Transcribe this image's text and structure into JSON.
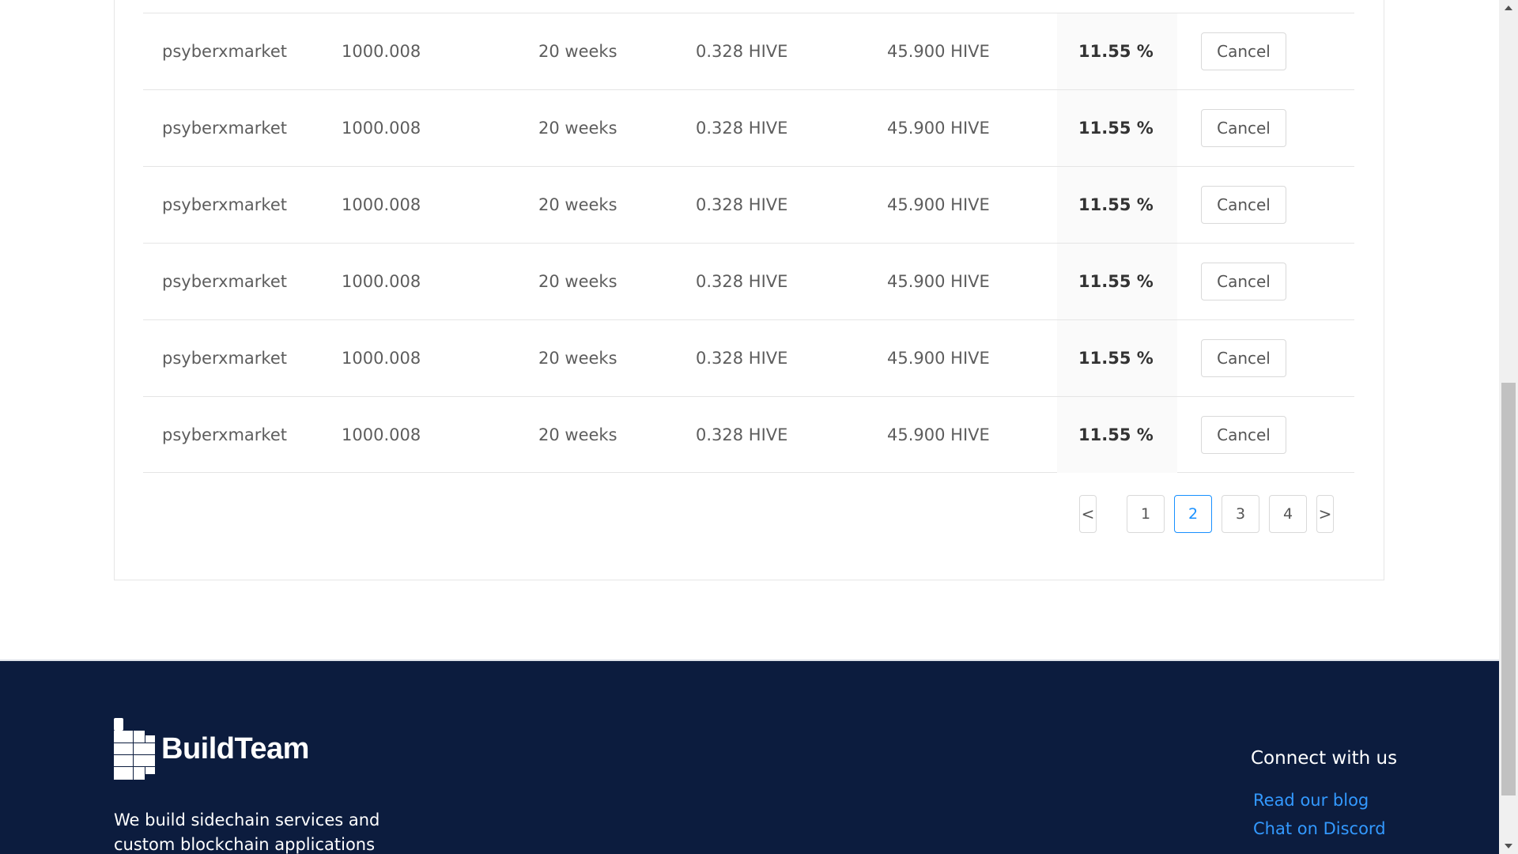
{
  "table": {
    "rows": [
      {
        "user": "psyberxmarket",
        "amount": "1000.008",
        "duration": "20 weeks",
        "fee": "0.328 HIVE",
        "total": "45.900 HIVE",
        "rate": "11.55 %",
        "action": "Cancel"
      },
      {
        "user": "psyberxmarket",
        "amount": "1000.008",
        "duration": "20 weeks",
        "fee": "0.328 HIVE",
        "total": "45.900 HIVE",
        "rate": "11.55 %",
        "action": "Cancel"
      },
      {
        "user": "psyberxmarket",
        "amount": "1000.008",
        "duration": "20 weeks",
        "fee": "0.328 HIVE",
        "total": "45.900 HIVE",
        "rate": "11.55 %",
        "action": "Cancel"
      },
      {
        "user": "psyberxmarket",
        "amount": "1000.008",
        "duration": "20 weeks",
        "fee": "0.328 HIVE",
        "total": "45.900 HIVE",
        "rate": "11.55 %",
        "action": "Cancel"
      },
      {
        "user": "psyberxmarket",
        "amount": "1000.008",
        "duration": "20 weeks",
        "fee": "0.328 HIVE",
        "total": "45.900 HIVE",
        "rate": "11.55 %",
        "action": "Cancel"
      },
      {
        "user": "psyberxmarket",
        "amount": "1000.008",
        "duration": "20 weeks",
        "fee": "0.328 HIVE",
        "total": "45.900 HIVE",
        "rate": "11.55 %",
        "action": "Cancel"
      }
    ]
  },
  "pagination": {
    "prev": "<",
    "next": ">",
    "pages": [
      "1",
      "2",
      "3",
      "4"
    ],
    "current": "2",
    "active_color": "#1890ff"
  },
  "footer": {
    "logo_text": "BuildTeam",
    "tagline": "We build sidechain services and custom blockchain applications",
    "connect_heading": "Connect with us",
    "links": [
      "Read our blog",
      "Chat on Discord"
    ],
    "background_color": "#0c1c3e",
    "link_color": "#3399ff"
  },
  "scrollbar": {
    "up_icon": "arrow-up-icon",
    "down_icon": "arrow-down-icon"
  }
}
